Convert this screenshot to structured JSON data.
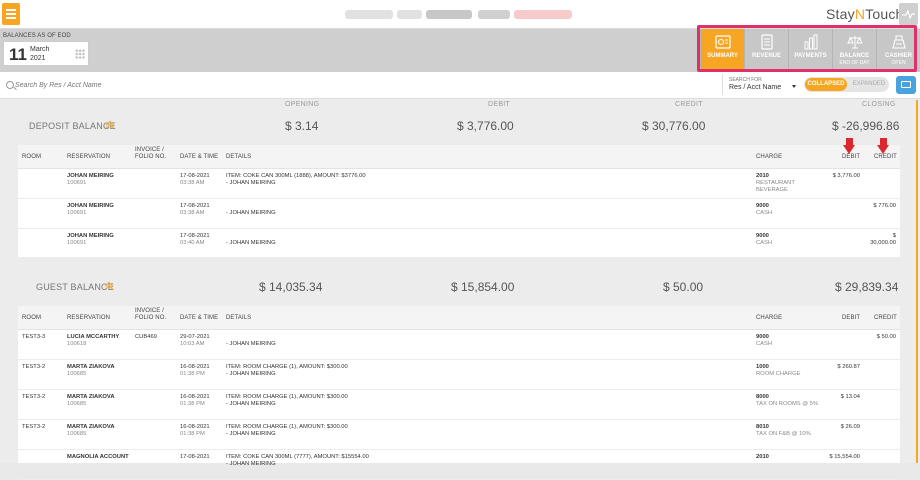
{
  "topbar": {
    "brand_left": "Stay",
    "brand_mid": "N",
    "brand_right": "Touch"
  },
  "header": {
    "balances_label": "BALANCES AS OF EOD",
    "date_day": "11",
    "date_month": "March",
    "date_year": "2021"
  },
  "tabs": [
    {
      "label": "SUMMARY",
      "sub": "",
      "icon": "summary-icon",
      "active": true
    },
    {
      "label": "REVENUE",
      "sub": "",
      "icon": "revenue-icon",
      "active": false
    },
    {
      "label": "PAYMENTS",
      "sub": "",
      "icon": "payments-icon",
      "active": false
    },
    {
      "label": "BALANCE",
      "sub": "END OF DAY",
      "icon": "scale-icon",
      "active": false
    },
    {
      "label": "CASHIER",
      "sub": "OPEN",
      "icon": "cashier-icon",
      "active": false
    }
  ],
  "search": {
    "placeholder": "Search By Res / Acct Name",
    "search_for_label": "SEARCH FOR",
    "search_for_value": "Res / Acct Name",
    "toggle_on": "COLLAPSED",
    "toggle_off": "EXPANDED"
  },
  "summary_columns": [
    "OPENING",
    "DEBIT",
    "CREDIT",
    "CLOSING"
  ],
  "table_headers": {
    "room": "ROOM",
    "reservation": "RESERVATION",
    "invoice_1": "INVOICE /",
    "invoice_2": "FOLIO NO.",
    "datetime": "DATE & TIME",
    "details": "DETAILS",
    "charge": "CHARGE",
    "debit": "DEBIT",
    "credit": "CREDIT"
  },
  "sections": [
    {
      "title": "DEPOSIT BALANCE",
      "opening": "$ 3.14",
      "debit": "$ 3,776.00",
      "credit": "$ 30,776.00",
      "closing": "$ -26,996.86",
      "rows": [
        {
          "room": "",
          "name": "JOHAN MEIRING",
          "resno": "100691",
          "invoice": "",
          "date": "17-08-2021",
          "time": "03:38 AM",
          "detail1": "ITEM: COKE CAN 300ML (1888), AMOUNT: $3776.00",
          "detail2": "- JOHAN MEIRING",
          "charge_code": "2010",
          "charge_desc1": "RESTAURANT",
          "charge_desc2": "BEVERAGE",
          "debit": "$ 3,776.00",
          "credit": "",
          "credit2": ""
        },
        {
          "room": "",
          "name": "JOHAN MEIRING",
          "resno": "100691",
          "invoice": "",
          "date": "17-08-2021",
          "time": "03:38 AM",
          "detail1": "",
          "detail2": "- JOHAN MEIRING",
          "charge_code": "9000",
          "charge_desc1": "CASH",
          "charge_desc2": "",
          "debit": "",
          "credit": "$ 776.00",
          "credit2": ""
        },
        {
          "room": "",
          "name": "JOHAN MEIRING",
          "resno": "100691",
          "invoice": "",
          "date": "17-08-2021",
          "time": "03:40 AM",
          "detail1": "",
          "detail2": "- JOHAN MEIRING",
          "charge_code": "9000",
          "charge_desc1": "CASH",
          "charge_desc2": "",
          "debit": "",
          "credit": "$",
          "credit2": "30,000.00"
        }
      ]
    },
    {
      "title": "GUEST BALANCE",
      "opening": "$ 14,035.34",
      "debit": "$ 15,854.00",
      "credit": "$ 50.00",
      "closing": "$ 29,839.34",
      "rows": [
        {
          "room": "TEST3-3",
          "name": "LUCIA MCCARTHY",
          "resno": "100618",
          "invoice": "CUB469",
          "date": "29-07-2021",
          "time": "10:03 AM",
          "detail1": "",
          "detail2": "- JOHAN MEIRING",
          "charge_code": "9000",
          "charge_desc1": "CASH",
          "charge_desc2": "",
          "debit": "",
          "credit": "$ 50.00",
          "credit2": ""
        },
        {
          "room": "TEST3-2",
          "name": "MARTA ZIAKOVA",
          "resno": "100685",
          "invoice": "",
          "date": "16-08-2021",
          "time": "01:38 PM",
          "detail1": "ITEM: ROOM CHARGE (1), AMOUNT: $300.00",
          "detail2": "- JOHAN MEIRING",
          "charge_code": "1000",
          "charge_desc1": "ROOM CHARGE",
          "charge_desc2": "",
          "debit": "$ 260.87",
          "credit": "",
          "credit2": ""
        },
        {
          "room": "TEST3-2",
          "name": "MARTA ZIAKOVA",
          "resno": "100685",
          "invoice": "",
          "date": "16-08-2021",
          "time": "01:38 PM",
          "detail1": "ITEM: ROOM CHARGE (1), AMOUNT: $300.00",
          "detail2": "- JOHAN MEIRING",
          "charge_code": "8000",
          "charge_desc1": "TAX ON ROOMS @ 5%",
          "charge_desc2": "",
          "debit": "$ 13.04",
          "credit": "",
          "credit2": ""
        },
        {
          "room": "TEST3-2",
          "name": "MARTA ZIAKOVA",
          "resno": "100685",
          "invoice": "",
          "date": "16-08-2021",
          "time": "01:38 PM",
          "detail1": "ITEM: ROOM CHARGE (1), AMOUNT: $300.00",
          "detail2": "- JOHAN MEIRING",
          "charge_code": "8010",
          "charge_desc1": "TAX ON F&B @ 10%",
          "charge_desc2": "",
          "debit": "$ 26.09",
          "credit": "",
          "credit2": ""
        },
        {
          "room": "",
          "name": "MAGNOLIA ACCOUNT",
          "resno": "",
          "invoice": "",
          "date": "17-08-2021",
          "time": "",
          "detail1": "ITEM: COKE CAN 300ML (7777), AMOUNT: $15554.00",
          "detail2": "- JOHAN MEIRING",
          "charge_code": "2010",
          "charge_desc1": "",
          "charge_desc2": "",
          "debit": "$ 15,554.00",
          "credit": "",
          "credit2": ""
        }
      ]
    }
  ],
  "colors": {
    "accent": "#f6a623",
    "highlight": "#e0306a",
    "arrow": "#d9282f",
    "print": "#4aa3df"
  }
}
